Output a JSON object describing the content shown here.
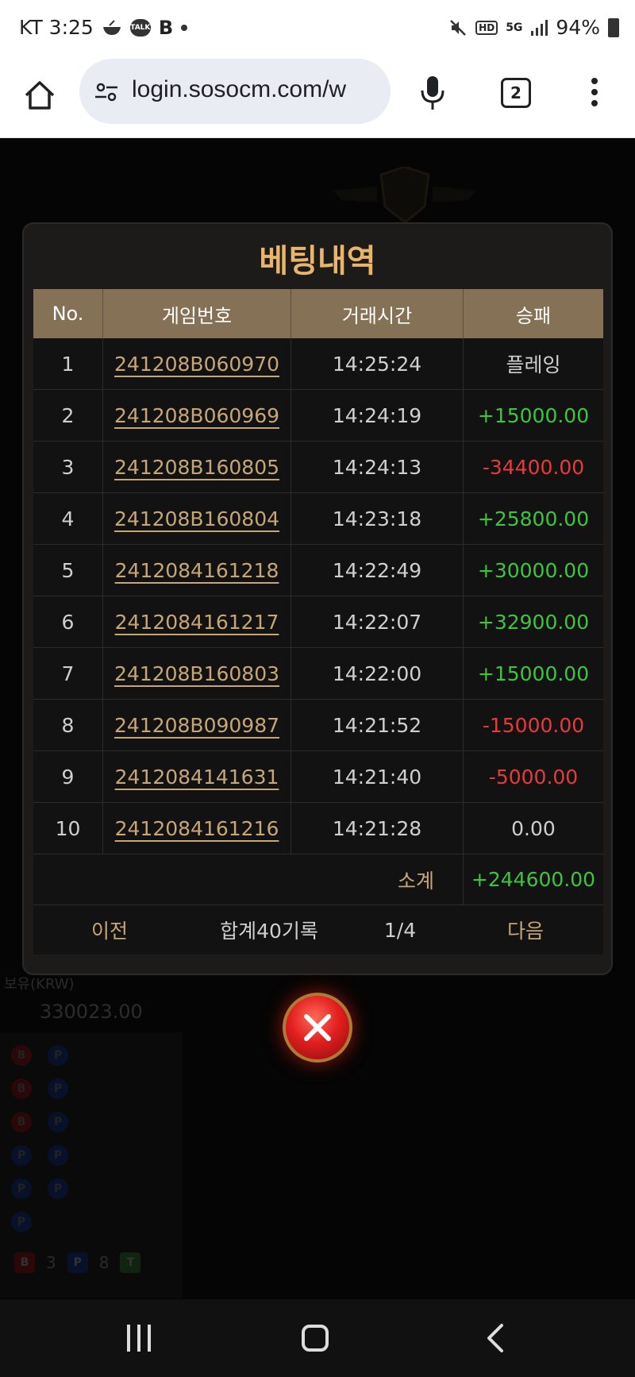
{
  "status_bar": {
    "carrier_time": "KT 3:25",
    "battery": "94%",
    "talk_label": "TALK",
    "b_label": "B",
    "hd_label": "HD",
    "net_label": "5G"
  },
  "browser": {
    "url": "login.sosocm.com/w",
    "tab_count": "2"
  },
  "background": {
    "balance_label": "보유(KRW)",
    "balance": "330023.00",
    "road_banker": "B",
    "road_player": "P",
    "legend": [
      {
        "label": "B",
        "count": "3"
      },
      {
        "label": "P",
        "count": "8"
      },
      {
        "label": "T",
        "count": ""
      }
    ]
  },
  "modal": {
    "title": "베팅내역",
    "headers": [
      "No.",
      "게임번호",
      "거래시간",
      "승패"
    ],
    "rows": [
      {
        "no": "1",
        "game": "241208B060970",
        "time": "14:25:24",
        "result": "플레잉",
        "type": "neutral"
      },
      {
        "no": "2",
        "game": "241208B060969",
        "time": "14:24:19",
        "result": "+15000.00",
        "type": "win"
      },
      {
        "no": "3",
        "game": "241208B160805",
        "time": "14:24:13",
        "result": "-34400.00",
        "type": "loss"
      },
      {
        "no": "4",
        "game": "241208B160804",
        "time": "14:23:18",
        "result": "+25800.00",
        "type": "win"
      },
      {
        "no": "5",
        "game": "2412084161218",
        "time": "14:22:49",
        "result": "+30000.00",
        "type": "win"
      },
      {
        "no": "6",
        "game": "2412084161217",
        "time": "14:22:07",
        "result": "+32900.00",
        "type": "win"
      },
      {
        "no": "7",
        "game": "241208B160803",
        "time": "14:22:00",
        "result": "+15000.00",
        "type": "win"
      },
      {
        "no": "8",
        "game": "241208B090987",
        "time": "14:21:52",
        "result": "-15000.00",
        "type": "loss"
      },
      {
        "no": "9",
        "game": "2412084141631",
        "time": "14:21:40",
        "result": "-5000.00",
        "type": "loss"
      },
      {
        "no": "10",
        "game": "2412084161216",
        "time": "14:21:28",
        "result": "0.00",
        "type": "neutral"
      }
    ],
    "subtotal_label": "소계",
    "subtotal_value": "+244600.00",
    "pager": {
      "prev": "이전",
      "total": "합계40기록",
      "page": "1/4",
      "next": "다음"
    }
  },
  "colors": {
    "gold": "#e9b56a",
    "win": "#3fc43f",
    "loss": "#e83a3a",
    "header_bg": "#857155"
  }
}
